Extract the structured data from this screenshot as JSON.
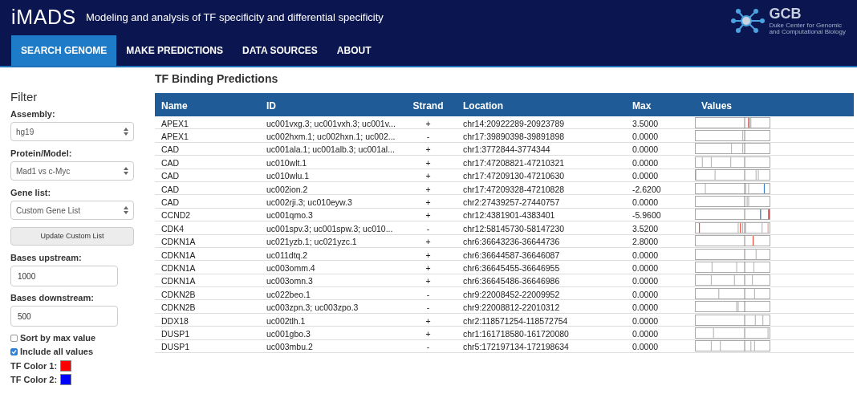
{
  "header": {
    "logo": "iMADS",
    "tagline": "Modeling and analysis of TF specificity and differential specificity",
    "org_short": "GCB",
    "org_line_1": "Duke Center for Genomic",
    "org_line_2": "and Computational Biology"
  },
  "nav": [
    {
      "label": "SEARCH GENOME",
      "selected": true
    },
    {
      "label": "MAKE PREDICTIONS",
      "selected": false
    },
    {
      "label": "DATA SOURCES",
      "selected": false
    },
    {
      "label": "ABOUT",
      "selected": false
    }
  ],
  "filter": {
    "title": "Filter",
    "assembly_label": "Assembly:",
    "assembly": "hg19",
    "model_label": "Protein/Model:",
    "model": "Mad1 vs c-Myc",
    "gene_list_label": "Gene list:",
    "gene_list": "Custom Gene List",
    "update_button": "Update Custom List",
    "upstream_label": "Bases upstream:",
    "upstream": "1000",
    "downstream_label": "Bases downstream:",
    "downstream": "500",
    "checkboxes": [
      {
        "label": "Sort by max value",
        "checked": false
      },
      {
        "label": "Include all values",
        "checked": true
      }
    ],
    "colors": [
      {
        "label": "TF Color 1:",
        "color": "#ff0000"
      },
      {
        "label": "TF Color 2:",
        "color": "#0000ff"
      }
    ]
  },
  "table": {
    "title": "TF Binding Predictions",
    "columns": [
      "Name",
      "ID",
      "Strand",
      "Location",
      "Max",
      "Values"
    ],
    "rows": [
      [
        "APEX1",
        "uc001vxg.3; uc001vxh.3; uc001v...",
        "+",
        "chr14:20922289-20923789",
        "3.5000"
      ],
      [
        "APEX1",
        "uc002hxm.1; uc002hxn.1; uc002...",
        "-",
        "chr17:39890398-39891898",
        "0.0000"
      ],
      [
        "CAD",
        "uc001ala.1; uc001alb.3; uc001al...",
        "+",
        "chr1:3772844-3774344",
        "0.0000"
      ],
      [
        "CAD",
        "uc010wlt.1",
        "+",
        "chr17:47208821-47210321",
        "0.0000"
      ],
      [
        "CAD",
        "uc010wlu.1",
        "+",
        "chr17:47209130-47210630",
        "0.0000"
      ],
      [
        "CAD",
        "uc002ion.2",
        "+",
        "chr17:47209328-47210828",
        "-2.6200"
      ],
      [
        "CAD",
        "uc002rji.3; uc010eyw.3",
        "+",
        "chr2:27439257-27440757",
        "0.0000"
      ],
      [
        "CCND2",
        "uc001qmo.3",
        "+",
        "chr12:4381901-4383401",
        "-5.9600"
      ],
      [
        "CDK4",
        "uc001spv.3; uc001spw.3; uc010...",
        "-",
        "chr12:58145730-58147230",
        "3.5200"
      ],
      [
        "CDKN1A",
        "uc021yzb.1; uc021yzc.1",
        "+",
        "chr6:36643236-36644736",
        "2.8000"
      ],
      [
        "CDKN1A",
        "uc011dtq.2",
        "+",
        "chr6:36644587-36646087",
        "0.0000"
      ],
      [
        "CDKN1A",
        "uc003omm.4",
        "+",
        "chr6:36645455-36646955",
        "0.0000"
      ],
      [
        "CDKN1A",
        "uc003omn.3",
        "+",
        "chr6:36645486-36646986",
        "0.0000"
      ],
      [
        "CDKN2B",
        "uc022beo.1",
        "-",
        "chr9:22008452-22009952",
        "0.0000"
      ],
      [
        "CDKN2B",
        "uc003zpn.3; uc003zpo.3",
        "-",
        "chr9:22008812-22010312",
        "0.0000"
      ],
      [
        "DDX18",
        "uc002tlh.1",
        "+",
        "chr2:118571254-118572754",
        "0.0000"
      ],
      [
        "DUSP1",
        "uc001gbo.3",
        "+",
        "chr1:161718580-161720080",
        "0.0000"
      ],
      [
        "DUSP1",
        "uc003mbu.2",
        "-",
        "chr5:172197134-172198634",
        "0.0000"
      ]
    ]
  }
}
